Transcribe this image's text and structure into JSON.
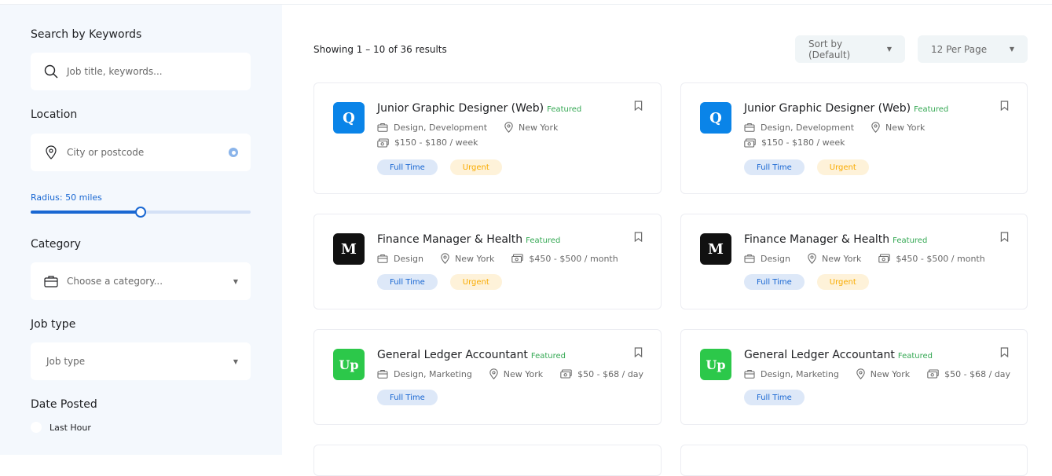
{
  "sidebar": {
    "keywords": {
      "title": "Search by Keywords",
      "placeholder": "Job title, keywords..."
    },
    "location": {
      "title": "Location",
      "placeholder": "City or postcode"
    },
    "radius": {
      "label": "Radius: 50 miles",
      "value_fraction": 0.5
    },
    "category": {
      "title": "Category",
      "placeholder": "Choose a category..."
    },
    "job_type": {
      "title": "Job type",
      "placeholder": "Job type"
    },
    "date_posted": {
      "title": "Date Posted",
      "options": [
        "Last Hour"
      ]
    }
  },
  "toolbar": {
    "results_text": "Showing 1 – 10 of 36 results",
    "sort_label": "Sort by (Default)",
    "per_page_label": "12 Per Page"
  },
  "colors": {
    "accent": "#1967d2",
    "featured": "#34a853",
    "sidebar_bg": "#f4f8fd"
  },
  "jobs": [
    {
      "title": "Junior Graphic Designer (Web)",
      "featured": "Featured",
      "logo": "Q",
      "logo_color": "#0a84e8",
      "category": "Design, Development",
      "location": "New York",
      "salary": "$150 - $180 / week",
      "tags": [
        "Full Time",
        "Urgent"
      ]
    },
    {
      "title": "Junior Graphic Designer (Web)",
      "featured": "Featured",
      "logo": "Q",
      "logo_color": "#0a84e8",
      "category": "Design, Development",
      "location": "New York",
      "salary": "$150 - $180 / week",
      "tags": [
        "Full Time",
        "Urgent"
      ]
    },
    {
      "title": "Finance Manager & Health",
      "featured": "Featured",
      "logo": "M",
      "logo_color": "#111111",
      "category": "Design",
      "location": "New York",
      "salary": "$450 - $500 / month",
      "tags": [
        "Full Time",
        "Urgent"
      ]
    },
    {
      "title": "Finance Manager & Health",
      "featured": "Featured",
      "logo": "M",
      "logo_color": "#111111",
      "category": "Design",
      "location": "New York",
      "salary": "$450 - $500 / month",
      "tags": [
        "Full Time",
        "Urgent"
      ]
    },
    {
      "title": "General Ledger Accountant",
      "featured": "Featured",
      "logo": "Up",
      "logo_color": "#2cc84a",
      "category": "Design, Marketing",
      "location": "New York",
      "salary": "$50 - $68 / day",
      "tags": [
        "Full Time"
      ]
    },
    {
      "title": "General Ledger Accountant",
      "featured": "Featured",
      "logo": "Up",
      "logo_color": "#2cc84a",
      "category": "Design, Marketing",
      "location": "New York",
      "salary": "$50 - $68 / day",
      "tags": [
        "Full Time"
      ]
    }
  ]
}
